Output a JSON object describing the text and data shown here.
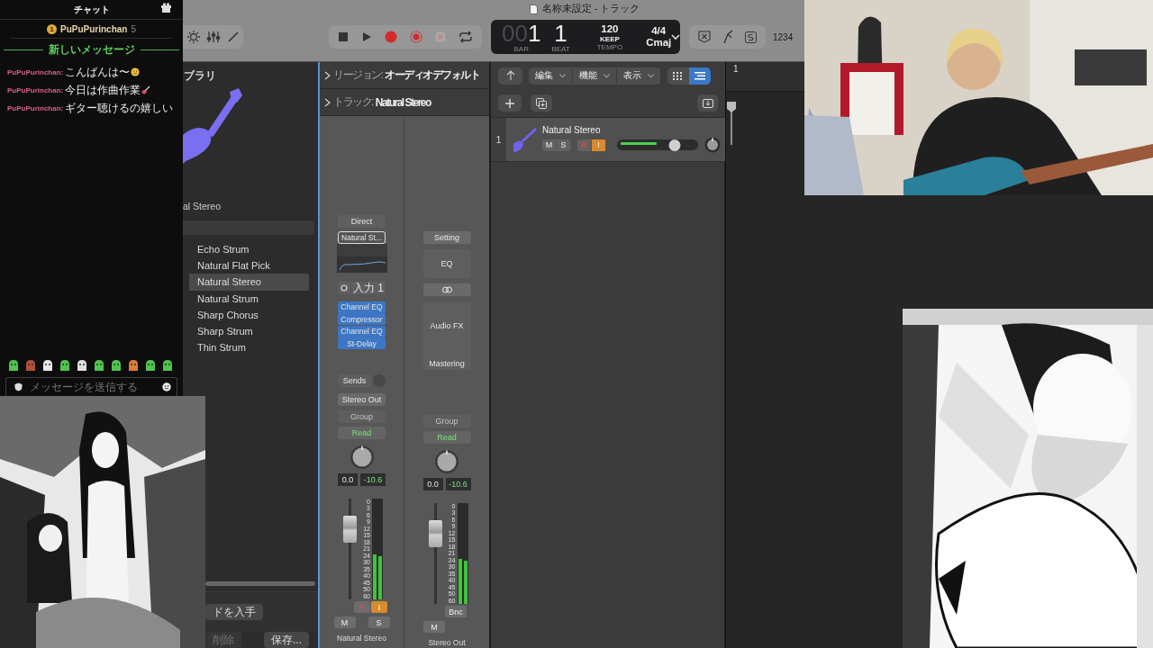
{
  "window": {
    "title": "名称未設定 - トラック"
  },
  "toolbar": {
    "counter": "1234"
  },
  "lcd": {
    "bar_lead": "00",
    "bar": "1",
    "beat": "1",
    "bar_label": "BAR",
    "beat_label": "BEAT",
    "tempo": "120",
    "tempo_mode": "KEEP",
    "tempo_label": "TEMPO",
    "signature": "4/4",
    "key": "Cmaj"
  },
  "chat": {
    "title": "チャット",
    "leader": {
      "rank": "1",
      "name": "PuPuPurinchan",
      "count": "5"
    },
    "divider": "新しいメッセージ",
    "messages": [
      {
        "user": "PuPuPurinchan:",
        "text": "こんばんは〜",
        "kind": "smiley"
      },
      {
        "user": "PuPuPurinchan:",
        "text": "今日は作曲作業",
        "kind": "guitar"
      },
      {
        "user": "PuPuPurinchan:",
        "text": "ギター聴けるの嬉しい",
        "kind": "plain"
      }
    ],
    "placeholder": "メッセージを送信する"
  },
  "library": {
    "header": "ブラリ",
    "patch_name": "al Stereo",
    "items": [
      {
        "label": "Echo Strum",
        "selected": false
      },
      {
        "label": "Natural Flat Pick",
        "selected": false
      },
      {
        "label": "Natural Stereo",
        "selected": true
      },
      {
        "label": "Natural Strum",
        "selected": false
      },
      {
        "label": "Sharp Chorus",
        "selected": false
      },
      {
        "label": "Sharp Strum",
        "selected": false
      },
      {
        "label": "Thin Strum",
        "selected": false
      }
    ],
    "get_button": "ドを入手",
    "buttons": [
      {
        "label": "削除",
        "disabled": true
      },
      {
        "label": "保存...",
        "disabled": false
      }
    ]
  },
  "inspector": {
    "rows": [
      {
        "label": "リージョン:",
        "value": "オーディオデフォルト"
      },
      {
        "label": "トラック:",
        "value": "Natural Stereo"
      }
    ]
  },
  "strips": [
    {
      "kind": "track",
      "mode": "Direct",
      "setting": "Natural St...",
      "input": "入力 1",
      "plugins": [
        "Channel EQ",
        "Compressor",
        "Channel EQ",
        "St-Delay"
      ],
      "sends": "Sends",
      "output": "Stereo Out",
      "group": "Group",
      "automation": "Read",
      "pan_value": "0.0",
      "peak": "-10.6",
      "fader": {
        "level": 0.7
      },
      "meter": {
        "level": 0.45
      },
      "scale": [
        "0",
        "3",
        "6",
        "9",
        "12",
        "15",
        "18",
        "21",
        "24",
        "30",
        "35",
        "40",
        "45",
        "50",
        "60"
      ],
      "buttons": [
        {
          "label": "R",
          "on": false
        },
        {
          "label": "I",
          "on": true
        }
      ],
      "mute_solo": [
        {
          "label": "M",
          "on": false
        },
        {
          "label": "S",
          "on": false
        }
      ],
      "name": "Natural Stereo"
    },
    {
      "kind": "output",
      "setting": "Setting",
      "eq_label": "EQ",
      "fx_label": "Audio FX",
      "mastering": "Mastering",
      "group": "Group",
      "automation": "Read",
      "pan_value": "0.0",
      "peak": "-10.6",
      "fader": {
        "level": 0.7
      },
      "meter": {
        "level": 0.45
      },
      "scale": [
        "0",
        "3",
        "6",
        "9",
        "12",
        "15",
        "18",
        "21",
        "24",
        "30",
        "35",
        "40",
        "45",
        "50",
        "60"
      ],
      "buttons": [
        {
          "label": "Bnc",
          "on": false
        }
      ],
      "mute_solo": [
        {
          "label": "M",
          "on": false
        }
      ],
      "name": "Stereo Out"
    }
  ],
  "tracks_toolbar": {
    "menus": [
      "編集",
      "機能",
      "表示"
    ],
    "views": [
      {
        "selected": false
      },
      {
        "selected": true
      }
    ]
  },
  "ruler": {
    "marks": [
      "1"
    ]
  },
  "tracks": [
    {
      "number": "1",
      "name": "Natural Stereo",
      "buttons": [
        {
          "label": "M",
          "on": false
        },
        {
          "label": "S",
          "on": false
        },
        {
          "label": "R",
          "on": false
        },
        {
          "label": "I",
          "on": true
        }
      ],
      "volume": {
        "level": 0.71
      }
    }
  ]
}
